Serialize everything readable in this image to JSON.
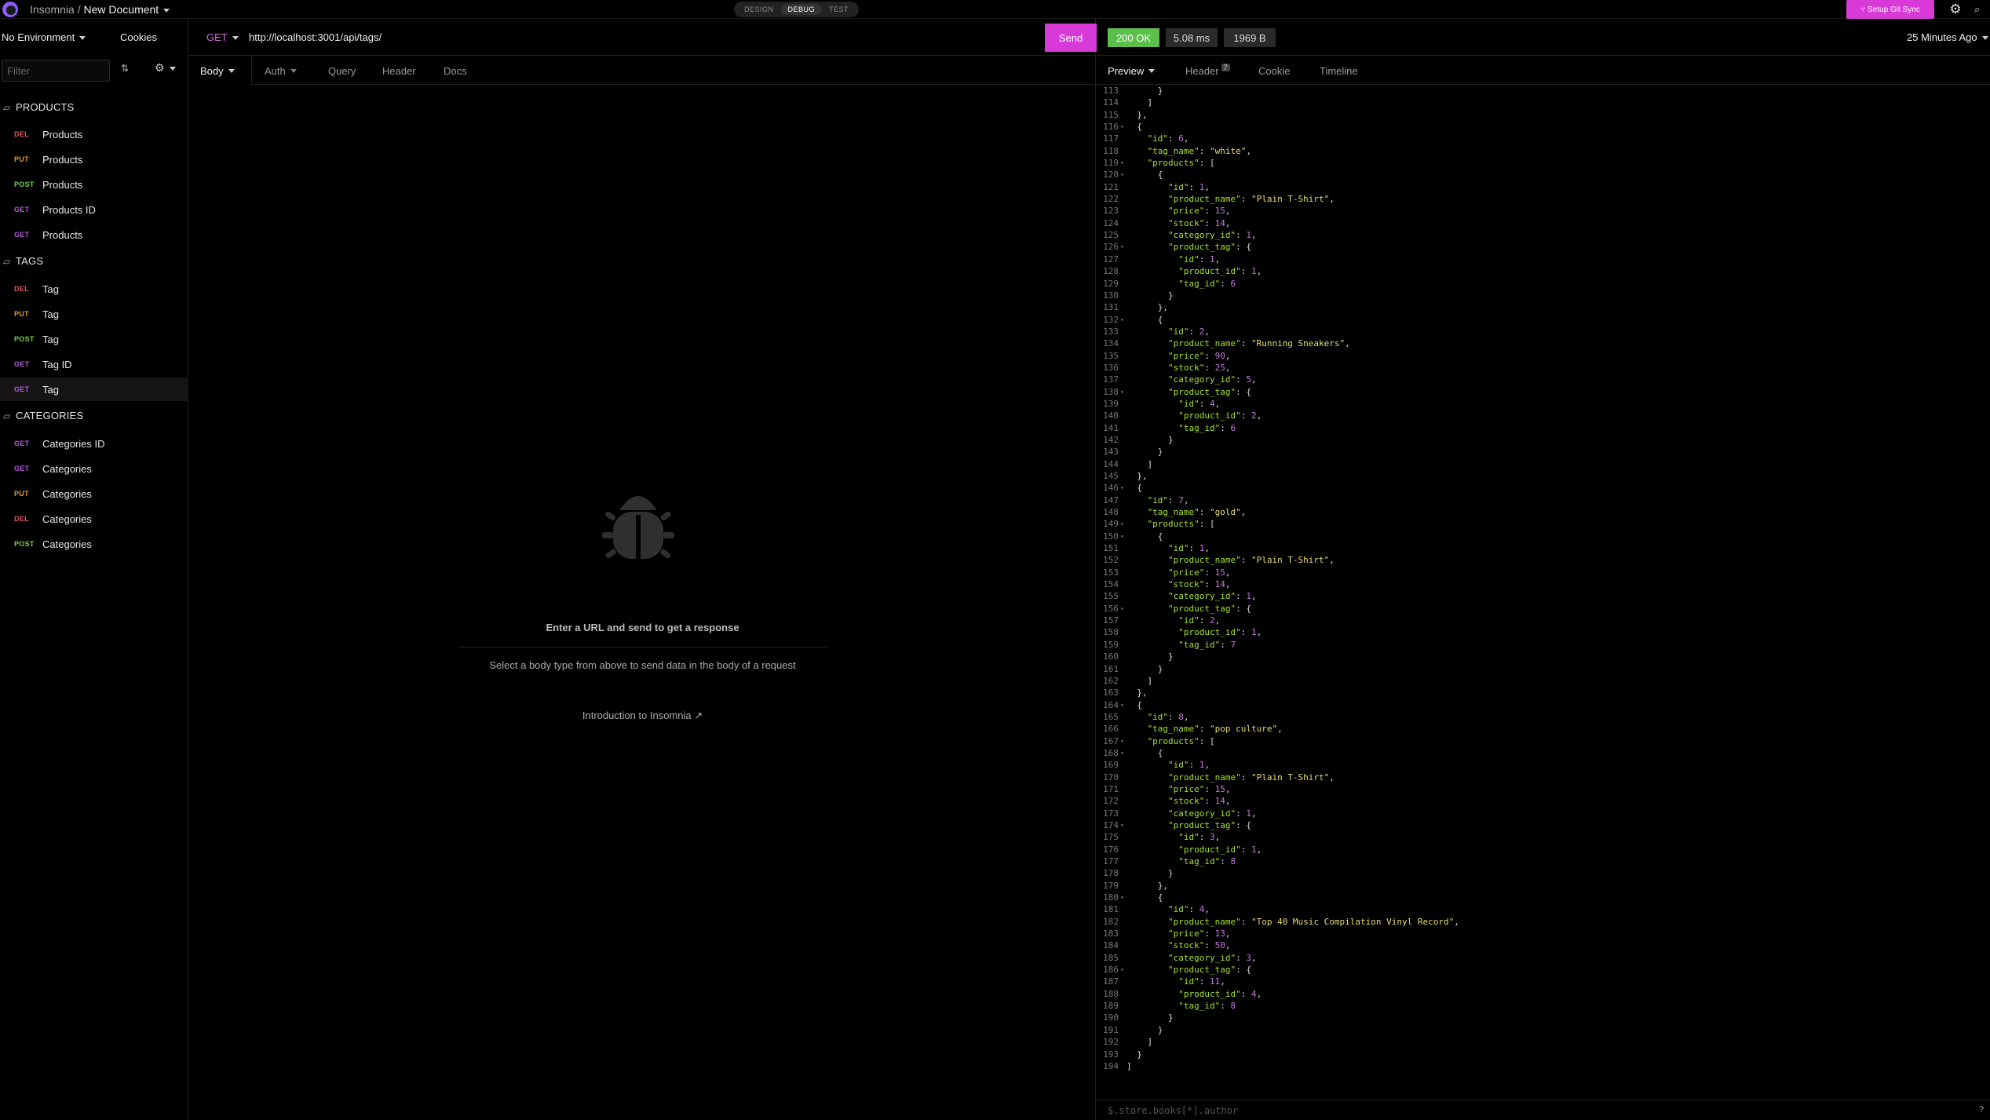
{
  "app": {
    "name": "Insomnia",
    "separator": "/",
    "document": "New Document"
  },
  "modes": [
    "DESIGN",
    "DEBUG",
    "TEST"
  ],
  "active_mode": "DEBUG",
  "topbar": {
    "git_sync": "⑂ Setup Git Sync"
  },
  "sidebar": {
    "environment": "No Environment",
    "cookies": "Cookies",
    "filter_placeholder": "Filter",
    "folders": [
      {
        "name": "PRODUCTS",
        "requests": [
          {
            "method": "DEL",
            "name": "Products"
          },
          {
            "method": "PUT",
            "name": "Products"
          },
          {
            "method": "POST",
            "name": "Products"
          },
          {
            "method": "GET",
            "name": "Products ID"
          },
          {
            "method": "GET",
            "name": "Products"
          }
        ]
      },
      {
        "name": "TAGS",
        "requests": [
          {
            "method": "DEL",
            "name": "Tag"
          },
          {
            "method": "PUT",
            "name": "Tag"
          },
          {
            "method": "POST",
            "name": "Tag"
          },
          {
            "method": "GET",
            "name": "Tag ID"
          },
          {
            "method": "GET",
            "name": "Tag",
            "active": true
          }
        ]
      },
      {
        "name": "CATEGORIES",
        "requests": [
          {
            "method": "GET",
            "name": "Categories ID"
          },
          {
            "method": "GET",
            "name": "Categories"
          },
          {
            "method": "PUT",
            "name": "Categories"
          },
          {
            "method": "DEL",
            "name": "Categories"
          },
          {
            "method": "POST",
            "name": "Categories"
          }
        ]
      }
    ]
  },
  "request": {
    "method": "GET",
    "url": "http://localhost:3001/api/tags/",
    "send_label": "Send",
    "tabs": {
      "body": "Body",
      "auth": "Auth",
      "query": "Query",
      "header": "Header",
      "docs": "Docs"
    },
    "empty_title": "Enter a URL and send to get a response",
    "empty_sub": "Select a body type from above to send data in the body of a request",
    "intro_link": "Introduction to Insomnia"
  },
  "response": {
    "status": "200 OK",
    "time": "5.08 ms",
    "size": "1969 B",
    "ago": "25 Minutes Ago",
    "tabs": {
      "preview": "Preview",
      "header": "Header",
      "header_count": "7",
      "cookie": "Cookie",
      "timeline": "Timeline"
    },
    "filter_placeholder": "$.store.books[*].author",
    "code_start_line": 113,
    "code_lines": [
      "      }",
      "    ]",
      "  },",
      "  {",
      "    \"id\": 6,",
      "    \"tag_name\": \"white\",",
      "    \"products\": [",
      "      {",
      "        \"id\": 1,",
      "        \"product_name\": \"Plain T-Shirt\",",
      "        \"price\": 15,",
      "        \"stock\": 14,",
      "        \"category_id\": 1,",
      "        \"product_tag\": {",
      "          \"id\": 1,",
      "          \"product_id\": 1,",
      "          \"tag_id\": 6",
      "        }",
      "      },",
      "      {",
      "        \"id\": 2,",
      "        \"product_name\": \"Running Sneakers\",",
      "        \"price\": 90,",
      "        \"stock\": 25,",
      "        \"category_id\": 5,",
      "        \"product_tag\": {",
      "          \"id\": 4,",
      "          \"product_id\": 2,",
      "          \"tag_id\": 6",
      "        }",
      "      }",
      "    ]",
      "  },",
      "  {",
      "    \"id\": 7,",
      "    \"tag_name\": \"gold\",",
      "    \"products\": [",
      "      {",
      "        \"id\": 1,",
      "        \"product_name\": \"Plain T-Shirt\",",
      "        \"price\": 15,",
      "        \"stock\": 14,",
      "        \"category_id\": 1,",
      "        \"product_tag\": {",
      "          \"id\": 2,",
      "          \"product_id\": 1,",
      "          \"tag_id\": 7",
      "        }",
      "      }",
      "    ]",
      "  },",
      "  {",
      "    \"id\": 8,",
      "    \"tag_name\": \"pop culture\",",
      "    \"products\": [",
      "      {",
      "        \"id\": 1,",
      "        \"product_name\": \"Plain T-Shirt\",",
      "        \"price\": 15,",
      "        \"stock\": 14,",
      "        \"category_id\": 1,",
      "        \"product_tag\": {",
      "          \"id\": 3,",
      "          \"product_id\": 1,",
      "          \"tag_id\": 8",
      "        }",
      "      },",
      "      {",
      "        \"id\": 4,",
      "        \"product_name\": \"Top 40 Music Compilation Vinyl Record\",",
      "        \"price\": 13,",
      "        \"stock\": 50,",
      "        \"category_id\": 3,",
      "        \"product_tag\": {",
      "          \"id\": 11,",
      "          \"product_id\": 4,",
      "          \"tag_id\": 8",
      "        }",
      "      }",
      "    ]",
      "  }",
      "]"
    ],
    "fold_lines": [
      116,
      119,
      120,
      126,
      132,
      138,
      146,
      149,
      150,
      156,
      164,
      167,
      168,
      174,
      180,
      186
    ]
  },
  "colors": {
    "accent": "#d83ad8",
    "status_ok": "#5cbf4b",
    "get": "#b35ad9",
    "put": "#e79b20",
    "post": "#6fcf4a",
    "del": "#e0575b"
  },
  "icons": [
    "logo-icon",
    "caret-icon",
    "gear-icon",
    "user-icon",
    "folder-icon",
    "sort-icon",
    "bug-icon",
    "external-link-icon",
    "help-icon"
  ]
}
